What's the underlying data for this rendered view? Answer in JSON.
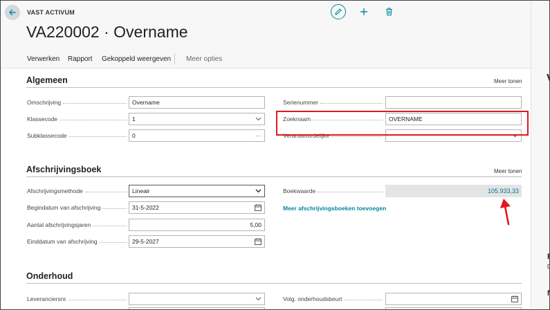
{
  "header": {
    "entity_type": "VAST ACTIVUM",
    "title": "VA220002 · Overname"
  },
  "actionbar": {
    "items": [
      "Verwerken",
      "Rapport",
      "Gekoppeld weergeven"
    ],
    "more": "Meer opties"
  },
  "algemeen": {
    "title": "Algemeen",
    "show_more": "Meer tonen",
    "omschrijving_label": "Omschrijving",
    "omschrijving_value": "Overname",
    "klassecode_label": "Klassecode",
    "klassecode_value": "1",
    "subklassecode_label": "Subklassecode",
    "subklassecode_value": "0",
    "subklassecode_suffix": "···",
    "serienummer_label": "Serienummer",
    "serienummer_value": "",
    "zoeknaam_label": "Zoeknaam",
    "zoeknaam_value": "OVERNAME",
    "verantwoordelijke_label": "Verantwoordelijke",
    "verantwoordelijke_value": ""
  },
  "afschrijvingsboek": {
    "title": "Afschrijvingsboek",
    "show_more": "Meer tonen",
    "methode_label": "Afschrijvingsmethode",
    "methode_value": "Lineair",
    "begindatum_label": "Begindatum van afschrijving",
    "begindatum_value": "31-5-2022",
    "jaren_label": "Aantal afschrijvingsjaren",
    "jaren_value": "5,00",
    "einddatum_label": "Einddatum van afschrijving",
    "einddatum_value": "29-5-2027",
    "boekwaarde_label": "Boekwaarde",
    "boekwaarde_value": "105.933,33",
    "add_books_link": "Meer afschrijvingsboeken toevoegen"
  },
  "onderhoud": {
    "title": "Onderhoud",
    "leverancier_label": "Leveranciersnr.",
    "leverancier_value": "",
    "volg_label": "Volg. onderhoudsbeurt",
    "volg_value": ""
  },
  "factbox": {
    "heading_letter": "V",
    "letter_e": "E",
    "letter_d": "D",
    "letter_n": "N"
  },
  "colors": {
    "accent": "#00889e",
    "highlight": "#e3161e",
    "page_bg": "#f7f7f7"
  }
}
